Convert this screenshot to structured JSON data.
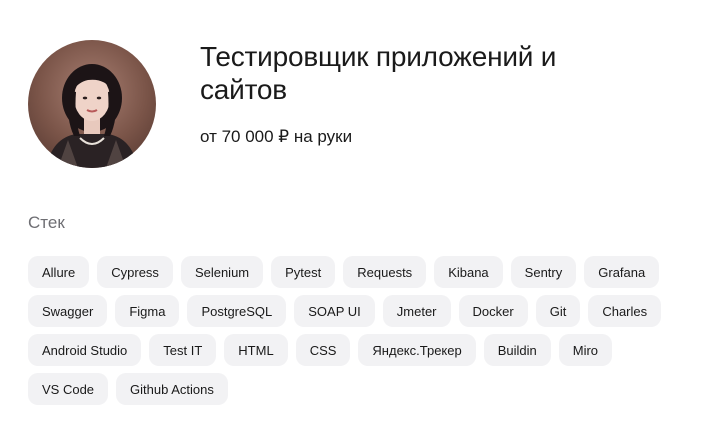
{
  "profile": {
    "title": "Тестировщик приложений и сайтов",
    "salary": "от 70 000 ₽ на руки"
  },
  "stack": {
    "heading": "Стек",
    "items": [
      "Allure",
      "Cypress",
      "Selenium",
      "Pytest",
      "Requests",
      "Kibana",
      "Sentry",
      "Grafana",
      "Swagger",
      "Figma",
      "PostgreSQL",
      "SOAP UI",
      "Jmeter",
      "Docker",
      "Git",
      "Charles",
      "Android Studio",
      "Test IT",
      "HTML",
      "CSS",
      "Яндекс.Трекер",
      "Buildin",
      "Miro",
      "VS Code",
      "Github Actions"
    ]
  }
}
